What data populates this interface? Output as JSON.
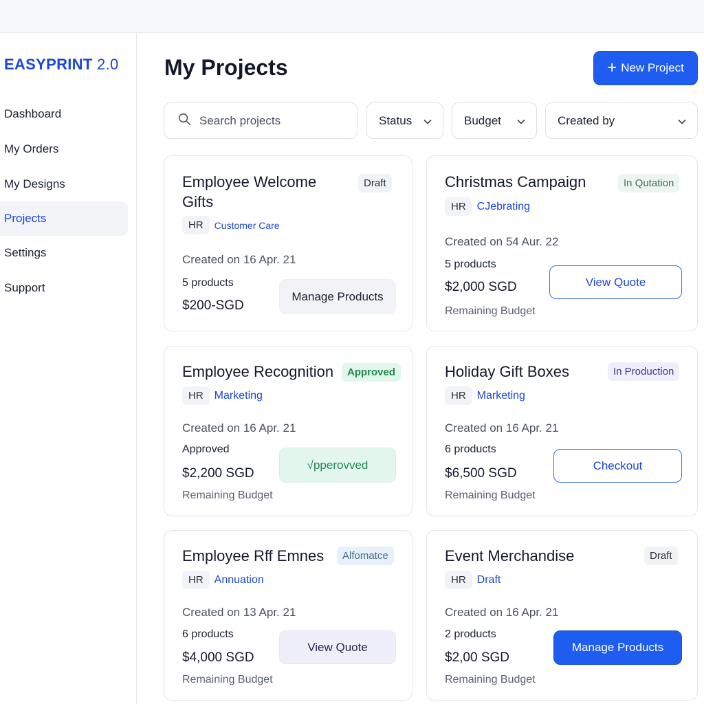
{
  "app": {
    "brand": "EASYPRINT",
    "version": "2.0"
  },
  "sidebar": {
    "items": [
      {
        "label": "Dashboard"
      },
      {
        "label": "My Orders"
      },
      {
        "label": "My Designs"
      },
      {
        "label": "Projects",
        "active": true
      },
      {
        "label": "Settings"
      },
      {
        "label": "Support"
      }
    ]
  },
  "header": {
    "title": "My Projects",
    "new_button": "New Project"
  },
  "filters": {
    "search_placeholder": "Search projects",
    "status": "Status",
    "budget": "Budget",
    "created_by": "Created by"
  },
  "projects": [
    {
      "title": "Employee Welcome Gifts",
      "status": "Draft",
      "tag": "HR",
      "dept": "Customer Care",
      "created": "Created on 16 Apr. 21",
      "count": "5 products",
      "price": "$200-SGD",
      "remaining": "",
      "action": "Manage Products"
    },
    {
      "title": "Christmas Campaign",
      "status": "In Qutation",
      "tag": "HR",
      "dept": "CJebrating",
      "created": "Created on 54 Aur. 22",
      "count": "5 products",
      "price": "$2,000 SGD",
      "remaining": "Remaining Budget",
      "action": "View Quote"
    },
    {
      "title": "Employee Recognition",
      "status": "Approved",
      "tag": "HR",
      "dept": "Marketing",
      "created": "Created on 16 Apr. 21",
      "count": "Approved",
      "price": "$2,200 SGD",
      "remaining": "Remaining Budget",
      "action": "√pperovved"
    },
    {
      "title": "Holiday Gift Boxes",
      "status": "In Production",
      "tag": "HR",
      "dept": "Marketing",
      "created": "Created on 16 Apr. 21",
      "count": "6 products",
      "price": "$6,500 SGD",
      "remaining": "Remaining Budget",
      "action": "Checkout"
    },
    {
      "title": "Employee Rff Emnes",
      "status": "Alfomatce",
      "tag": "HR",
      "dept": "Annuation",
      "created": "Created on 13 Apr. 21",
      "count": "6 products",
      "price": "$4,000 SGD",
      "remaining": "Remaining Budget",
      "action": "View Quote"
    },
    {
      "title": "Event Merchandise",
      "status": "Draft",
      "tag": "HR",
      "dept": "Draft",
      "created": "Created on 16 Apr. 21",
      "count": "2 products",
      "price": "$2,00 SGD",
      "remaining": "Remaining Budget",
      "action": "Manage Products"
    }
  ],
  "colors": {
    "accent": "#1f5df0",
    "brand": "#1b46d8",
    "approved": "#1f8a4c"
  },
  "icons": [
    "search-icon",
    "plus-icon",
    "chevron-down-icon"
  ]
}
